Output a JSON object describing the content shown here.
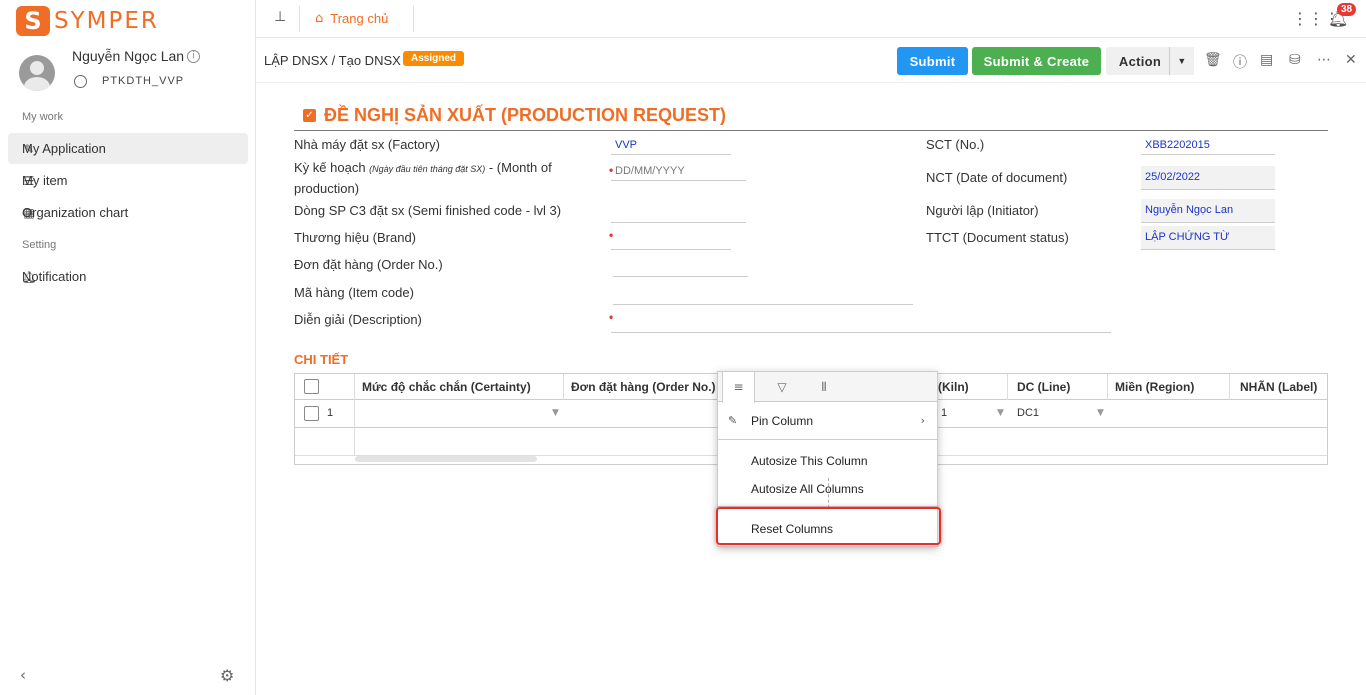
{
  "brand": {
    "logo_letter": "S",
    "logo_text": "SYMPER",
    "accent": "#f06d26"
  },
  "user": {
    "name": "Nguyễn Ngọc Lan",
    "dept": "PTKDTH_VVP"
  },
  "sidebar": {
    "section_work": "My work",
    "items": [
      {
        "label": "My Application",
        "icon": "edit-icon",
        "active": true
      },
      {
        "label": "My item",
        "icon": "list-icon"
      },
      {
        "label": "Organization chart",
        "icon": "org-chart-icon"
      }
    ],
    "section_setting": "Setting",
    "settings_items": [
      {
        "label": "Notification",
        "icon": "bell-icon"
      }
    ]
  },
  "topbar": {
    "home_label": "Trang chủ",
    "notification_count": "38"
  },
  "toolbar": {
    "breadcrumb": "LẬP DNSX / Tạo DNSX",
    "status": "Assigned",
    "submit": "Submit",
    "submit_create": "Submit & Create",
    "action": "Action"
  },
  "form": {
    "title": "ĐỀ NGHỊ SẢN XUẤT (PRODUCTION REQUEST)",
    "factory_label": "Nhà máy đặt sx (Factory)",
    "factory_value": "VVP",
    "plan_label_a": "Kỳ kế hoạch ",
    "plan_label_hint": "(Ngày đầu tiên tháng đặt SX)",
    "plan_label_b": " - (Month of production)",
    "plan_placeholder": "DD/MM/YYYY",
    "semi_label": "Dòng SP C3 đặt sx (Semi finished code - lvl 3)",
    "brand_label": "Thương hiệu (Brand)",
    "order_label": "Đơn đặt hàng (Order No.)",
    "item_label": "Mã hàng (Item code)",
    "desc_label": "Diễn giải (Description)",
    "sct_label": "SCT (No.)",
    "sct_value": "XBB2202015",
    "nct_label": "NCT (Date of document)",
    "nct_value": "25/02/2022",
    "initiator_label": "Người lập (Initiator)",
    "initiator_value": "Nguyễn Ngọc Lan",
    "status_label": "TTCT (Document status)",
    "status_value": "LẬP CHỨNG TỪ",
    "detail_title": "CHI TIẾT"
  },
  "grid": {
    "columns": [
      "Mức độ chắc chắn (Certainty)",
      "Đơn đặt hàng (Order No.)",
      "(Kiln)",
      "DC (Line)",
      "Miền (Region)",
      "NHÃN (Label)"
    ],
    "row": {
      "index": "1",
      "kiln": "1",
      "dc": "DC1"
    }
  },
  "column_menu": {
    "pin": "Pin Column",
    "autosize_this": "Autosize This Column",
    "autosize_all": "Autosize All Columns",
    "reset": "Reset Columns"
  }
}
